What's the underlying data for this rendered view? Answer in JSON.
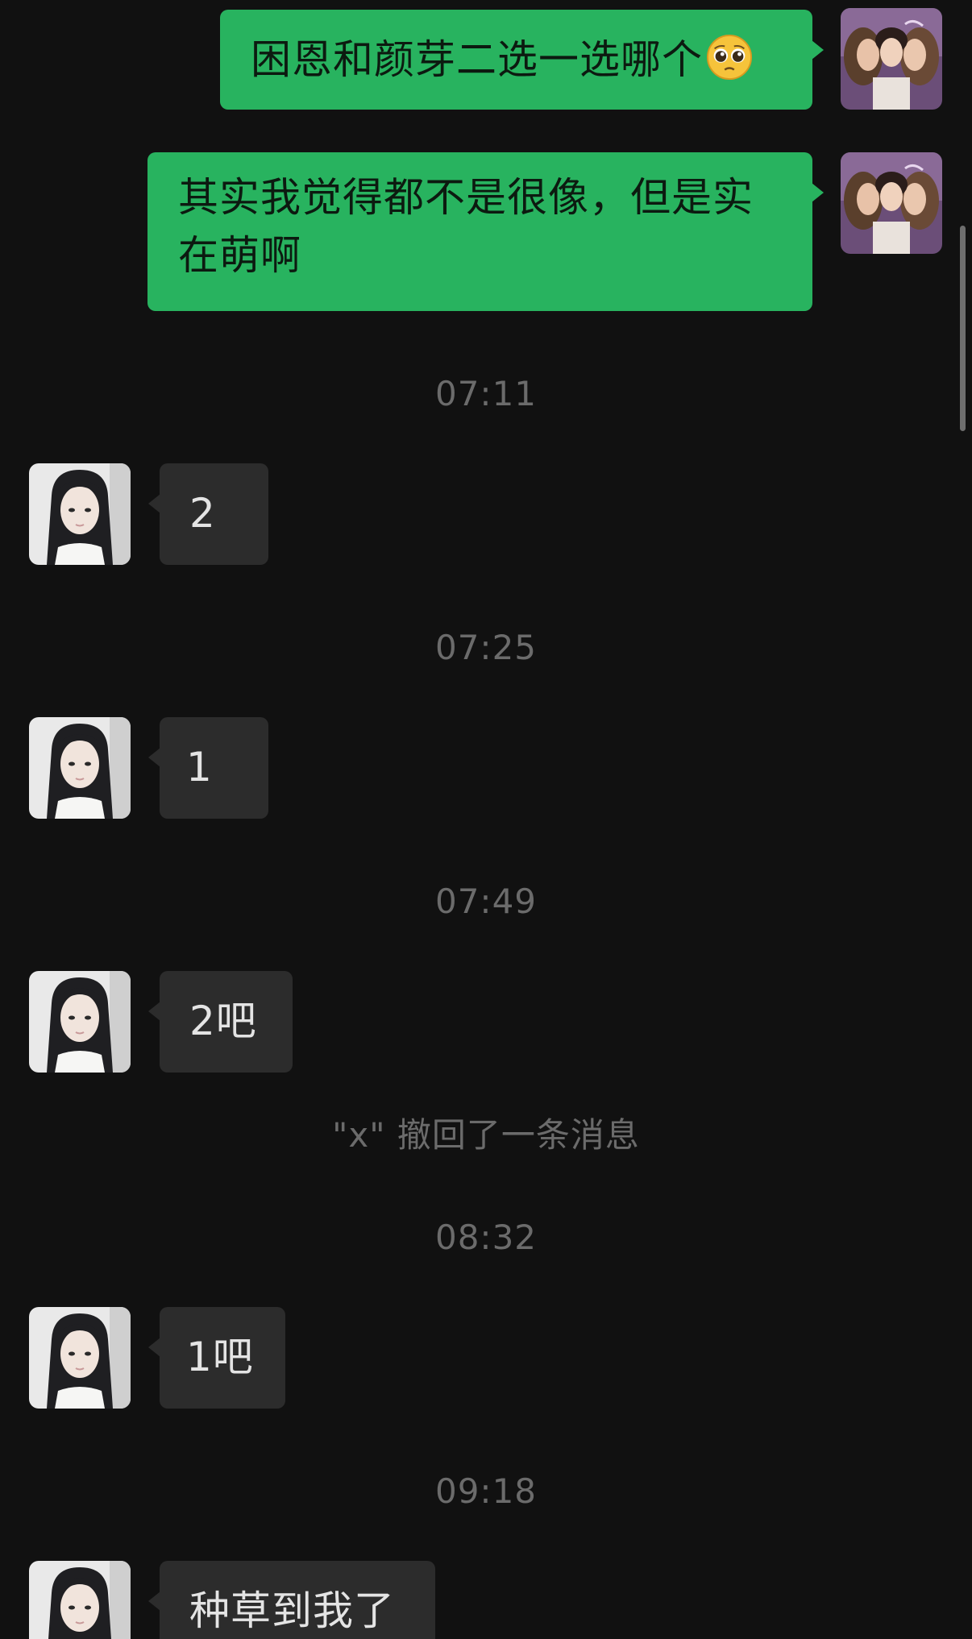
{
  "messages": [
    {
      "type": "outgoing",
      "text": "困恩和颜芽二选一选哪个",
      "emoji": "pleading-face-emoji"
    },
    {
      "type": "outgoing",
      "text_line1": "其实我觉得都不是很像，但是实",
      "text_line2": "在萌啊"
    },
    {
      "type": "timestamp",
      "text": "07:11"
    },
    {
      "type": "incoming",
      "text": "2"
    },
    {
      "type": "timestamp",
      "text": "07:25"
    },
    {
      "type": "incoming",
      "text": "1"
    },
    {
      "type": "timestamp",
      "text": "07:49"
    },
    {
      "type": "incoming",
      "text": "2吧"
    },
    {
      "type": "system",
      "text": "\"x\" 撤回了一条消息"
    },
    {
      "type": "timestamp",
      "text": "08:32"
    },
    {
      "type": "incoming",
      "text": "1吧"
    },
    {
      "type": "timestamp",
      "text": "09:18"
    },
    {
      "type": "incoming",
      "text": "种草到我了"
    }
  ],
  "colors": {
    "background": "#111111",
    "outgoing_bubble": "#28b35f",
    "incoming_bubble": "#2c2c2c",
    "timestamp_text": "#6b6b6b"
  },
  "icons": {
    "self_avatar": "self-avatar-photo",
    "contact_avatar": "contact-avatar-photo"
  }
}
